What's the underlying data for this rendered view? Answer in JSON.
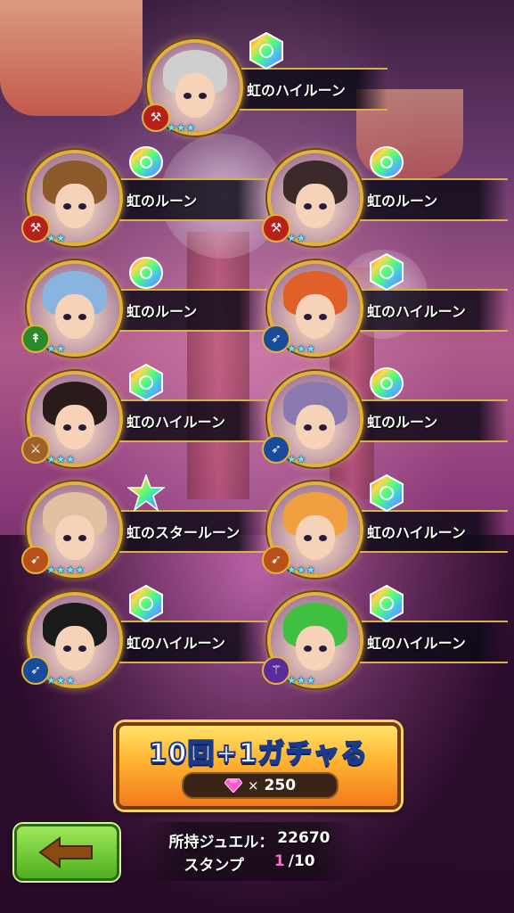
{
  "units": [
    {
      "rune": "虹のハイルーン",
      "rune_type": "hexagon",
      "weapon": "axe",
      "weapon_color": "#b8201a",
      "stars": "★★★",
      "hair": "#cfcfcf"
    },
    {
      "rune": "虹のルーン",
      "rune_type": "round",
      "weapon": "axe",
      "weapon_color": "#b8201a",
      "stars": "★★",
      "hair": "#8a5a2a"
    },
    {
      "rune": "虹のルーン",
      "rune_type": "round",
      "weapon": "axe",
      "weapon_color": "#b8201a",
      "stars": "★★",
      "hair": "#3a2a2a"
    },
    {
      "rune": "虹のルーン",
      "rune_type": "round",
      "weapon": "spear",
      "weapon_color": "#2a8a2a",
      "stars": "★★",
      "hair": "#8ab4e0"
    },
    {
      "rune": "虹のハイルーン",
      "rune_type": "hexagon",
      "weapon": "lance",
      "weapon_color": "#1a4a9a",
      "stars": "★★★",
      "hair": "#e0602a"
    },
    {
      "rune": "虹のハイルーン",
      "rune_type": "hexagon",
      "weapon": "sword",
      "weapon_color": "#a0602a",
      "stars": "★★★",
      "hair": "#2a1a1a"
    },
    {
      "rune": "虹のルーン",
      "rune_type": "round",
      "weapon": "lance",
      "weapon_color": "#1a4a9a",
      "stars": "★★",
      "hair": "#8a7ab0"
    },
    {
      "rune": "虹のスタールーン",
      "rune_type": "star",
      "weapon": "bow",
      "weapon_color": "#b8501a",
      "stars": "★★★★",
      "hair": "#e0c0a0"
    },
    {
      "rune": "虹のハイルーン",
      "rune_type": "hexagon",
      "weapon": "bow",
      "weapon_color": "#b8501a",
      "stars": "★★★",
      "hair": "#f0a040"
    },
    {
      "rune": "虹のハイルーン",
      "rune_type": "hexagon",
      "weapon": "lance",
      "weapon_color": "#1a4a9a",
      "stars": "★★★",
      "hair": "#1a1a1a"
    },
    {
      "rune": "虹のハイルーン",
      "rune_type": "hexagon",
      "weapon": "staff",
      "weapon_color": "#5a2a9a",
      "stars": "★★★",
      "hair": "#40c040"
    }
  ],
  "gacha": {
    "title": "10回+1ガチャる",
    "cost_x": "×",
    "cost": "250",
    "gem_icon": "gem-icon"
  },
  "back": {
    "icon": "arrow-left-icon"
  },
  "info": {
    "jewel_label": "所持ジュエル：",
    "jewel_value": "22670",
    "stamp_label": "スタンプ",
    "stamp_current": "1",
    "stamp_total": "/10"
  }
}
